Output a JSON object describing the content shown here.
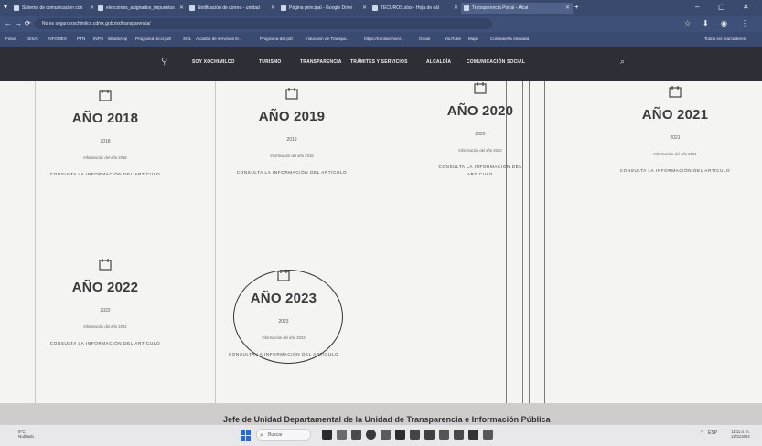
{
  "browser": {
    "tabs": [
      {
        "label": "Sistema de comunicación con",
        "active": false
      },
      {
        "label": "elecciones_asignados_impuestos",
        "active": false
      },
      {
        "label": "Notificación de correo - unidad",
        "active": false
      },
      {
        "label": "Página principal - Google Drive",
        "active": false
      },
      {
        "label": "TECUROS.xlsx - Hoja de cál",
        "active": false
      },
      {
        "label": "Transparencia Portal - Alcal",
        "active": true
      }
    ],
    "new_tab": "+",
    "url": "No es seguro  xochimilco.cdmx.gob.mx/transparencia/",
    "bookmarks": [
      "Fotos",
      "SISAI",
      "INFOMEX",
      "PTN",
      "INFO",
      "WhatsApp",
      "Programa-diccr.pdf",
      "SOL",
      "Alcaldía de servicios fil...",
      "Programa-der.pdf",
      "Inducción de Transpa...",
      "https://transarchivol...",
      "Gmail",
      "YouTube",
      "Maps",
      "Contraseña olvidada",
      "Todos los marcadores"
    ]
  },
  "site_nav": {
    "items": [
      "SOY XOCHIMILCO",
      "TURISMO",
      "TRANSPARENCIA",
      "TRÁMITES Y SERVICIOS",
      "ALCALDÍA",
      "COMUNICACIÓN SOCIAL"
    ]
  },
  "cards": [
    {
      "year": "AÑO 2018",
      "sub": "2018",
      "info": "Información del año 2018",
      "link": "CONSULTA LA INFORMACIÓN DEL ARTÍCULO"
    },
    {
      "year": "AÑO 2019",
      "sub": "2019",
      "info": "Información del año 2019",
      "link": "CONSULTA LA INFORMACIÓN DEL ARTÍCULO"
    },
    {
      "year": "AÑO 2020",
      "sub": "2020",
      "info": "Información del año 2020",
      "link": "CONSULTA LA INFORMACIÓN DEL ARTÍCULO"
    },
    {
      "year": "AÑO 2021",
      "sub": "2021",
      "info": "Información del año 2021",
      "link": "CONSULTA LA INFORMACIÓN DEL ARTÍCULO"
    },
    {
      "year": "AÑO 2022",
      "sub": "2022",
      "info": "Información del año 2022",
      "link": "CONSULTA LA INFORMACIÓN DEL ARTÍCULO"
    },
    {
      "year": "AÑO 2023",
      "sub": "2023",
      "info": "Información del año 2023",
      "link": "CONSULTA LA INFORMACIÓN DEL ARTÍCULO"
    }
  ],
  "footer": {
    "text": "Jefe de Unidad Departamental de la Unidad de Transparencia e Información Pública"
  },
  "taskbar": {
    "weather_temp": "9°C",
    "weather_desc": "Nublado",
    "search_placeholder": "Buscar",
    "tray_lang": "ESP",
    "time": "11:11 a. m.",
    "date": "11/01/2024"
  },
  "colors": {
    "tab_bar": "#3a4a6e",
    "site_nav": "#2e2e36",
    "content_bg": "#f4f4f3",
    "start_blue": "#2b6bd1"
  }
}
